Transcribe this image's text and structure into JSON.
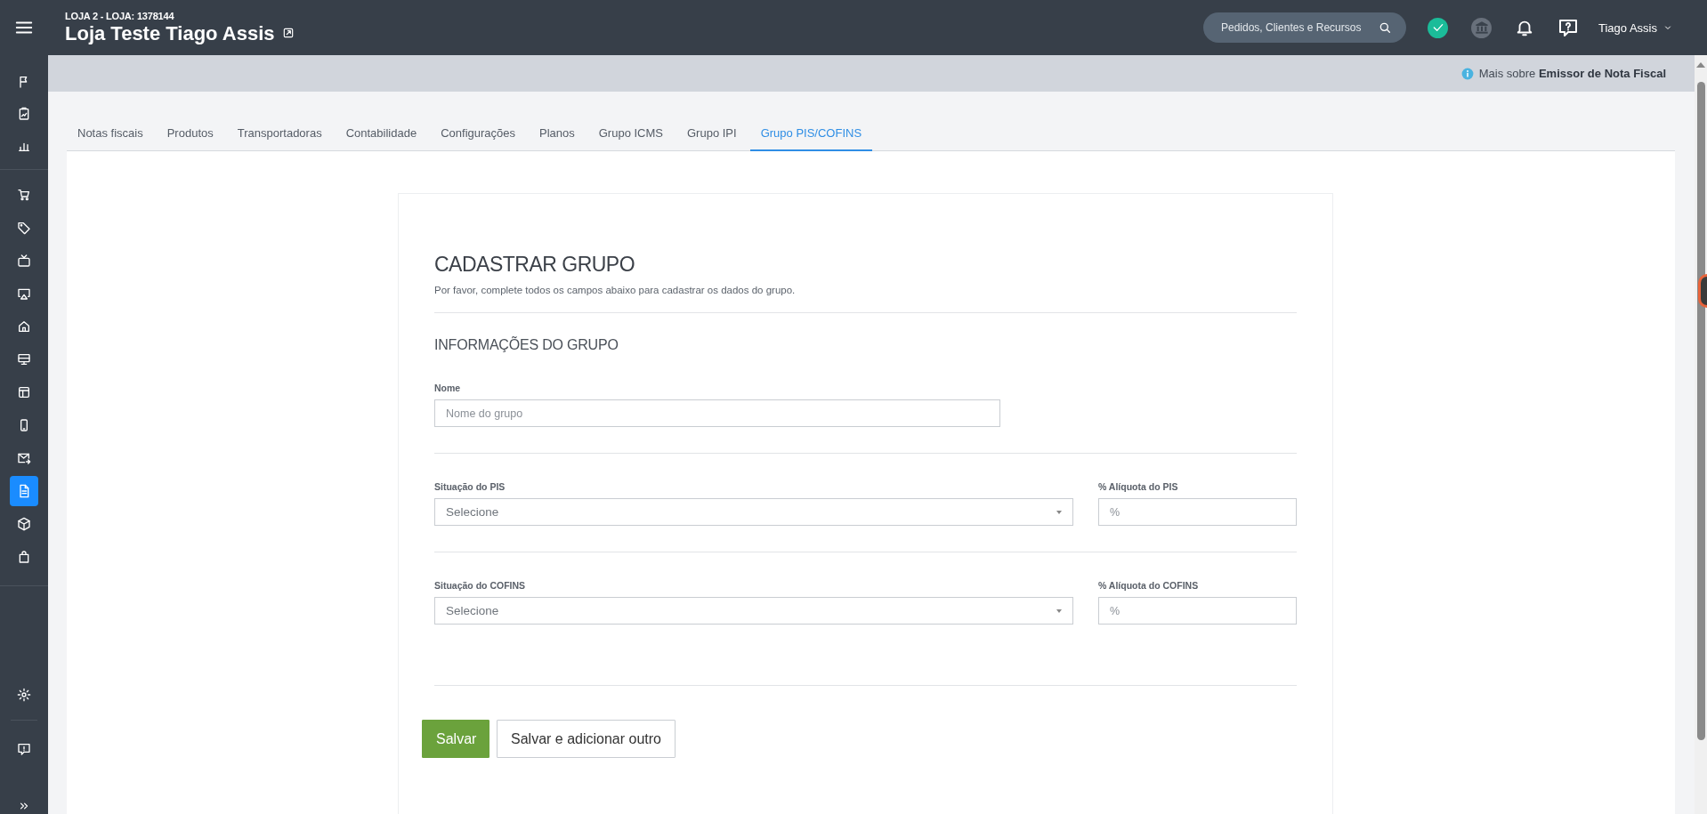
{
  "header": {
    "store_code": "LOJA 2 - LOJA: 1378144",
    "store_name": "Loja Teste Tiago Assis",
    "search": {
      "placeholder": "Pedidos, Clientes e Recursos"
    },
    "user": "Tiago Assis"
  },
  "sidebar": {
    "groups": [
      {
        "items": [
          {
            "selected": false
          },
          {
            "selected": false
          },
          {
            "selected": false
          }
        ]
      },
      {
        "items": [
          {
            "selected": false
          },
          {
            "selected": false
          },
          {
            "selected": false
          },
          {
            "selected": false
          },
          {
            "selected": false
          },
          {
            "selected": false
          },
          {
            "selected": false
          },
          {
            "selected": false
          },
          {
            "selected": false
          },
          {
            "selected": true
          },
          {
            "selected": false
          },
          {
            "selected": false
          }
        ]
      },
      {
        "items": [
          {
            "selected": false
          }
        ]
      },
      {
        "items": [
          {
            "selected": false
          }
        ]
      }
    ]
  },
  "info_bar": {
    "text": "Mais sobre **Emissor de Nota Fiscal**"
  },
  "tabs": [
    {
      "label": "Notas fiscais",
      "selected": false
    },
    {
      "label": "Produtos",
      "selected": false
    },
    {
      "label": "Transportadoras",
      "selected": false
    },
    {
      "label": "Contabilidade",
      "selected": false
    },
    {
      "label": "Configurações",
      "selected": false
    },
    {
      "label": "Planos",
      "selected": false
    },
    {
      "label": "Grupo ICMS",
      "selected": false
    },
    {
      "label": "Grupo IPI",
      "selected": false
    },
    {
      "label": "Grupo PIS/COFINS",
      "selected": true
    }
  ],
  "form": {
    "title": "CADASTRAR GRUPO",
    "subtitle": "Por favor, complete todos os campos abaixo para cadastrar os dados do grupo.",
    "section": "INFORMAÇÕES DO GRUPO",
    "rows": [
      {
        "fields": [
          {
            "kind": "text",
            "label": "Nome",
            "placeholder": "Nome do grupo"
          }
        ]
      },
      {
        "fields": [
          {
            "kind": "select",
            "label": "Situação do PIS",
            "placeholder": "Selecione"
          },
          {
            "kind": "percent",
            "label": "% Alíquota do PIS",
            "placeholder": "%"
          }
        ]
      },
      {
        "fields": [
          {
            "kind": "select",
            "label": "Situação do COFINS",
            "placeholder": "Selecione"
          },
          {
            "kind": "percent",
            "label": "% Alíquota do COFINS",
            "placeholder": "%"
          }
        ]
      }
    ],
    "buttons": [
      {
        "label": "Salvar",
        "kind": "primary"
      },
      {
        "label": "Salvar e adicionar outro",
        "kind": "secondary"
      }
    ]
  }
}
